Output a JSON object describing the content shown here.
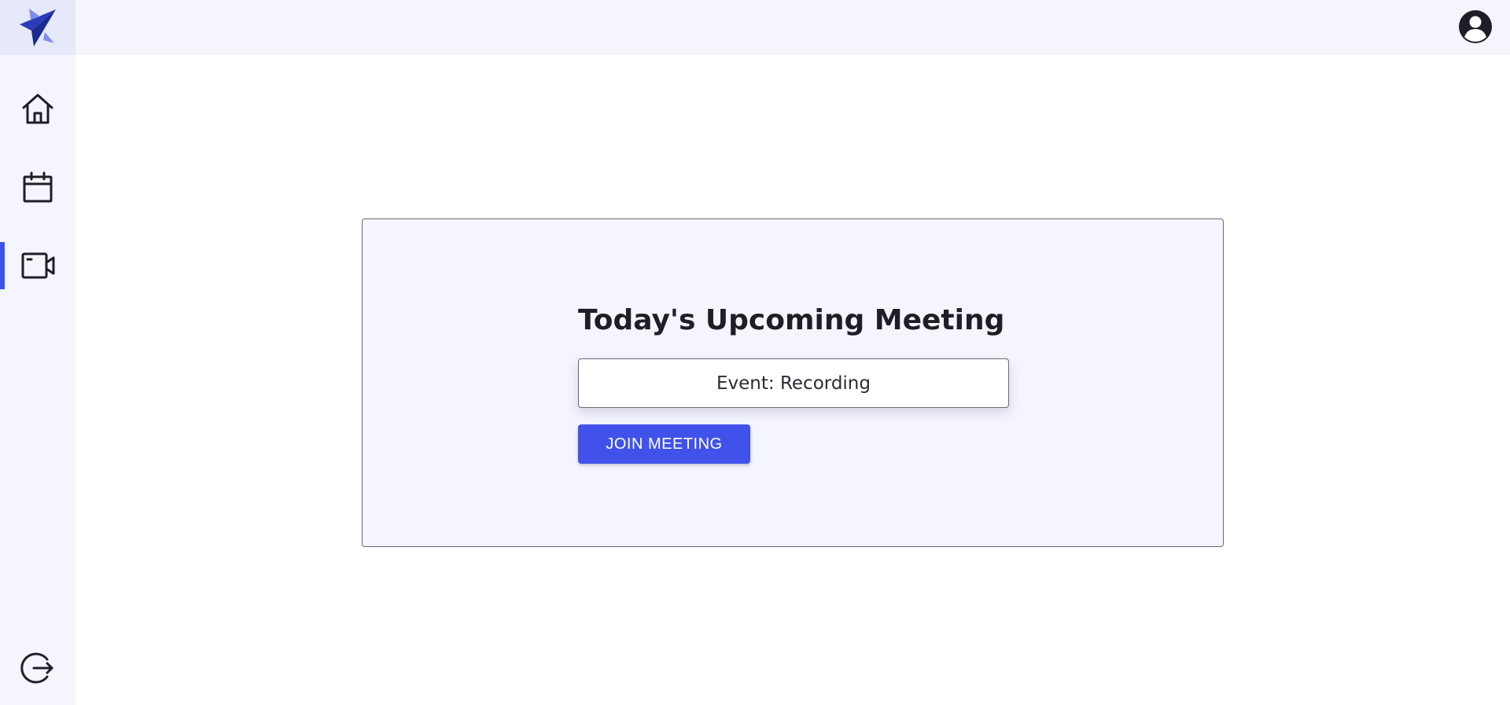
{
  "colors": {
    "accent": "#4052ea",
    "sidebar_bg": "#f4f5fd",
    "logo_bg": "#e6e9fa",
    "card_bg": "#f4f5fd",
    "text": "#1e1f26"
  },
  "sidebar": {
    "logo_icon": "paper-plane-logo-icon",
    "items": [
      {
        "icon": "home-icon",
        "active": false
      },
      {
        "icon": "calendar-icon",
        "active": false
      },
      {
        "icon": "video-camera-icon",
        "active": true
      },
      {
        "icon": "logout-icon",
        "active": false
      }
    ]
  },
  "header": {
    "avatar_icon": "user-account-icon"
  },
  "meeting": {
    "title": "Today's Upcoming Meeting",
    "event": "Event: Recording",
    "join_label": "JOIN MEETING"
  }
}
